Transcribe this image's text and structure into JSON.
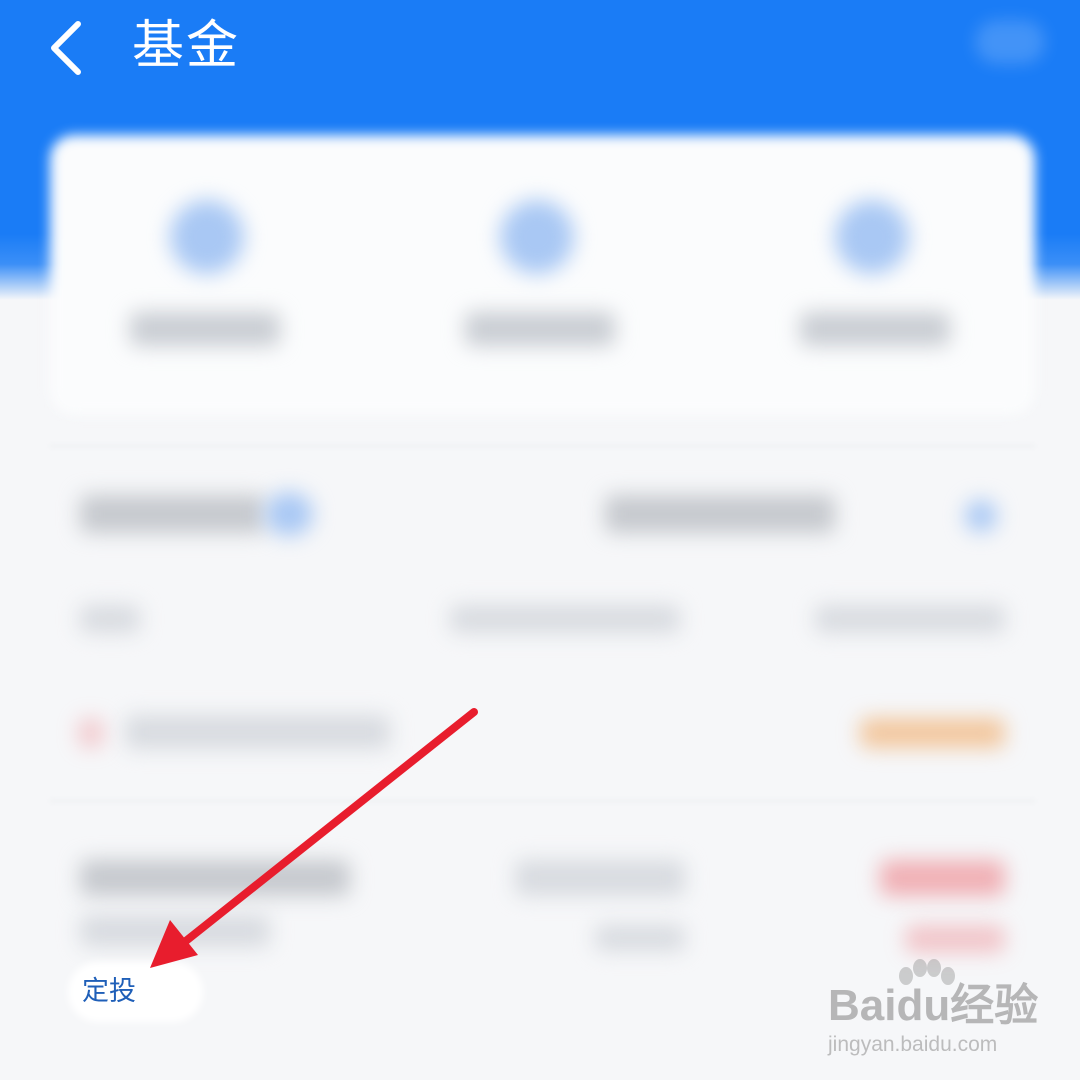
{
  "header": {
    "title": "基金",
    "background": "#1a7cf6"
  },
  "feature_item": {
    "label": "定投"
  },
  "watermark": {
    "brand": "Baidu经验",
    "url": "jingyan.baidu.com"
  },
  "annotation": {
    "arrow_color": "#e81d2d"
  },
  "icons": [
    "chevron-left-icon",
    "blurred-nav-icon",
    "baidu-paw-icon"
  ]
}
